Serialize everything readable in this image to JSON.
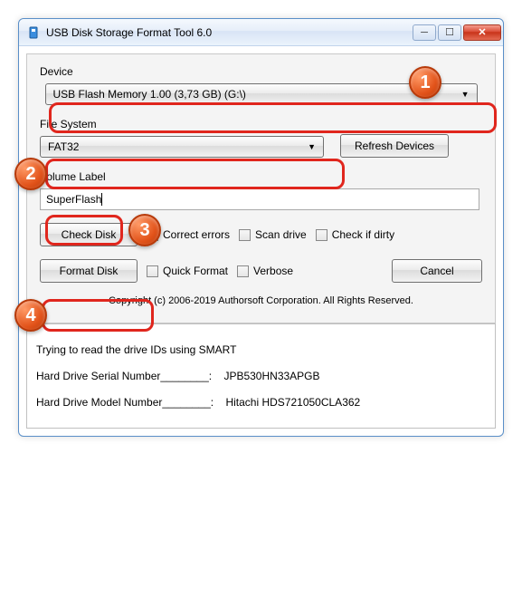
{
  "window": {
    "title": "USB Disk Storage Format Tool 6.0",
    "minimize": "─",
    "maximize": "☐",
    "close": "✕"
  },
  "labels": {
    "device": "Device",
    "filesystem": "File System",
    "volume": "Volume Label"
  },
  "device": {
    "selected": "USB Flash Memory  1.00 (3,73 GB) (G:\\)"
  },
  "filesystem": {
    "selected": "FAT32"
  },
  "volume": {
    "value": "SuperFlash"
  },
  "buttons": {
    "refresh": "Refresh Devices",
    "check": "Check Disk",
    "format": "Format Disk",
    "cancel": "Cancel"
  },
  "checks": {
    "correct": "Correct errors",
    "scan": "Scan drive",
    "dirty": "Check if dirty",
    "quick": "Quick Format",
    "verbose": "Verbose"
  },
  "copyright": "Copyright (c) 2006-2019 Authorsoft Corporation. All Rights Reserved.",
  "log": {
    "line1": "Trying to read the drive IDs using SMART",
    "line2a": "Hard Drive Serial Number________:",
    "line2b": "JPB530HN33APGB",
    "line3a": "Hard Drive Model Number________:",
    "line3b": "Hitachi HDS721050CLA362"
  },
  "badges": {
    "1": "1",
    "2": "2",
    "3": "3",
    "4": "4"
  }
}
